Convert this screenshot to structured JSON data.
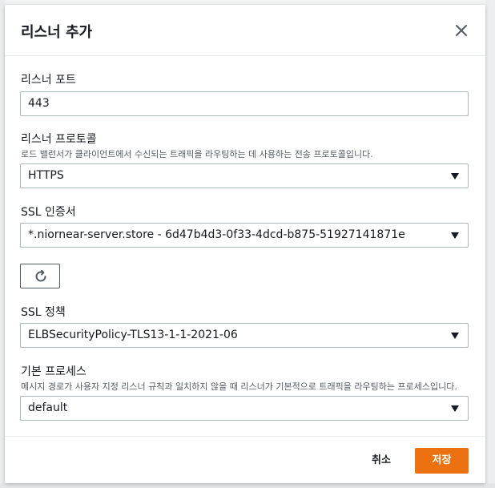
{
  "modal": {
    "title": "리스너 추가",
    "close_icon": "close-icon"
  },
  "listener_port": {
    "label": "리스너 포트",
    "value": "443"
  },
  "listener_protocol": {
    "label": "리스너 프로토콜",
    "description": "로드 밸런서가 클라이언트에서 수신되는 트래픽을 라우팅하는 데 사용하는 전송 프로토콜입니다.",
    "selected": "HTTPS"
  },
  "ssl_certificate": {
    "label": "SSL 인증서",
    "selected": "*.niornear-server.store - 6d47b4d3-0f33-4dcd-b875-51927141871e",
    "refresh_icon": "refresh-icon"
  },
  "ssl_policy": {
    "label": "SSL 정책",
    "selected": "ELBSecurityPolicy-TLS13-1-1-2021-06"
  },
  "default_process": {
    "label": "기본 프로세스",
    "description": "메시지 경로가 사용자 지정 리스너 규칙과 일치하지 않을 때 리스너가 기본적으로 트래픽을 라우팅하는 프로세스입니다.",
    "selected": "default"
  },
  "footer": {
    "cancel_label": "취소",
    "save_label": "저장"
  },
  "colors": {
    "primary_button": "#ec7211",
    "border": "#aab7b8",
    "text": "#16191f"
  }
}
